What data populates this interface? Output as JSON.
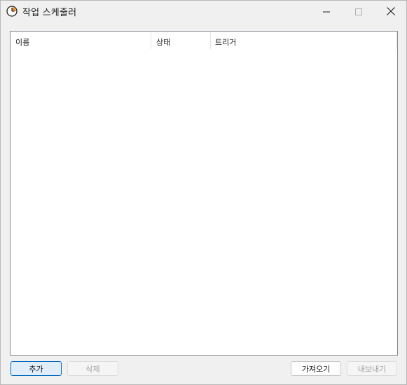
{
  "window": {
    "title": "작업 스케줄러",
    "icon": "clock-icon"
  },
  "titlebar_controls": {
    "minimize": "minimize-icon",
    "maximize": "maximize-icon",
    "close": "close-icon"
  },
  "task_list": {
    "columns": [
      "이름",
      "상태",
      "트리거"
    ],
    "rows": []
  },
  "buttons": {
    "add": "추가",
    "delete": "삭제",
    "import": "가져오기",
    "export": "내보내기"
  },
  "colors": {
    "accent": "#0067c0",
    "icon_orange": "#f08c1e"
  }
}
